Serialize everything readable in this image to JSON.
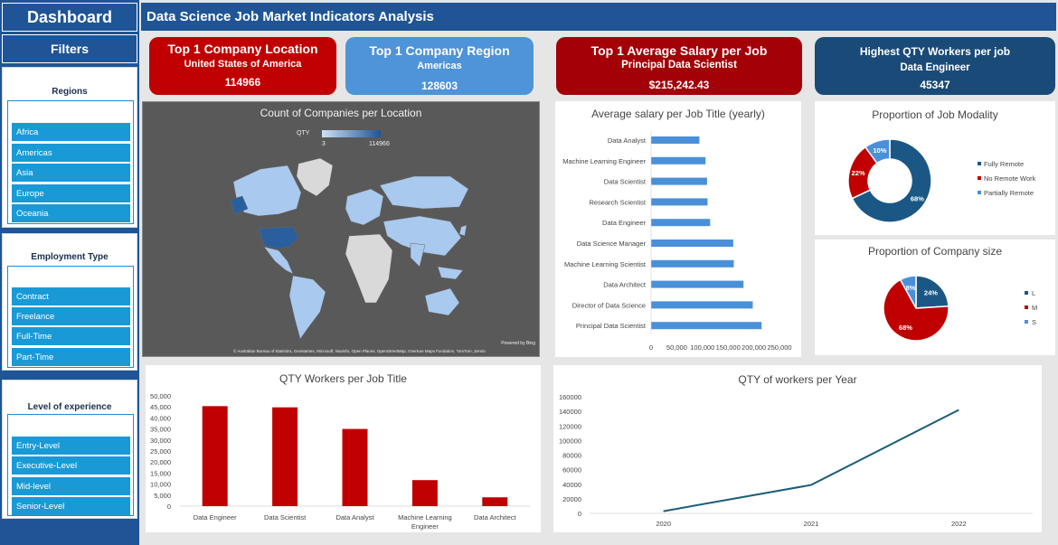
{
  "sidebar": {
    "title": "Dashboard",
    "filters_label": "Filters",
    "regions": {
      "header": "Regions",
      "items": [
        "Africa",
        "Americas",
        "Asia",
        "Europe",
        "Oceania"
      ]
    },
    "employment": {
      "header": "Employment Type",
      "items": [
        "Contract",
        "Freelance",
        "Full-Time",
        "Part-Time"
      ]
    },
    "experience": {
      "header": "Level of experience",
      "items": [
        "Entry-Level",
        "Executive-Level",
        "Mid-level",
        "Senior-Level"
      ]
    }
  },
  "header": {
    "title": "Data Science Job Market Indicators Analysis"
  },
  "kpis": [
    {
      "label": "Top 1 Company Location",
      "value_name": "United States of America",
      "value": "114966",
      "color": "#c00000"
    },
    {
      "label": "Top 1 Company Region",
      "value_name": "Americas",
      "value": "128603",
      "color": "#4f93d8"
    },
    {
      "label": "Top 1 Average Salary per Job",
      "value_name": "Principal Data Scientist",
      "value": "$215,242.43",
      "color": "#a30008"
    },
    {
      "label": "Highest QTY Workers per job",
      "value_name": "Data Engineer",
      "value": "45347",
      "color": "#1a4b78"
    }
  ],
  "map": {
    "title": "Count of Companies per Location",
    "legend_label": "QTY",
    "legend_min": "3",
    "legend_max": "114966",
    "attribution": "© Australian Bureau of Statistics, GeoNames, Microsoft, Navinfo, Open Places, OpenStreetMap, Overture Maps Fundation, TomTom, Zenrin",
    "powered_by": "Powered by Bing"
  },
  "colors": {
    "blue_bar": "#4a90d9",
    "red_bar": "#c00000",
    "navy": "#1a5785",
    "line": "#1a5d7a"
  },
  "charts": {
    "salary": {
      "title": "Average salary per Job Title (yearly)",
      "chart_data": {
        "type": "bar",
        "orientation": "horizontal",
        "categories": [
          "Data Analyst",
          "Machine Learning Engineer",
          "Data Scientist",
          "Research Scientist",
          "Data Engineer",
          "Data Science Manager",
          "Machine Learning Scientist",
          "Data Architect",
          "Director of Data Science",
          "Principal Data Scientist"
        ],
        "values": [
          94000,
          106000,
          109000,
          110000,
          115000,
          160000,
          161000,
          180000,
          198000,
          215242
        ],
        "xlim": [
          0,
          250000
        ],
        "xticks": [
          "0",
          "50,000",
          "100,000",
          "150,000",
          "200,000",
          "250,000"
        ]
      }
    },
    "modality": {
      "title": "Proportion of Job Modality",
      "chart_data": {
        "type": "pie",
        "donut": true,
        "labels": [
          "Fully Remote",
          "No Remote Work",
          "Partially Remote"
        ],
        "values": [
          68,
          22,
          10
        ],
        "data_labels": [
          "68%",
          "22%",
          "10%"
        ],
        "colors": [
          "#1a5785",
          "#c00000",
          "#4a90d9"
        ]
      }
    },
    "company_size": {
      "title": "Proportion of Company size",
      "chart_data": {
        "type": "pie",
        "labels": [
          "L",
          "M",
          "S"
        ],
        "values": [
          24,
          68,
          8
        ],
        "data_labels": [
          "24%",
          "68%",
          "8%"
        ],
        "colors": [
          "#1a5785",
          "#c00000",
          "#4a90d9"
        ]
      }
    },
    "workers_job": {
      "title": "QTY Workers per Job Title",
      "chart_data": {
        "type": "bar",
        "categories": [
          "Data Engineer",
          "Data Scientist",
          "Data Analyst",
          "Machine Learning Engineer",
          "Data Architect"
        ],
        "values": [
          45347,
          44800,
          35000,
          11800,
          4000
        ],
        "ylim": [
          0,
          50000
        ],
        "yticks": [
          "0",
          "5,000",
          "10,000",
          "15,000",
          "20,000",
          "25,000",
          "30,000",
          "35,000",
          "40,000",
          "45,000",
          "50,000"
        ]
      }
    },
    "workers_year": {
      "title": "QTY of workers per Year",
      "chart_data": {
        "type": "line",
        "x": [
          "2020",
          "2021",
          "2022"
        ],
        "values": [
          3000,
          39000,
          142000
        ],
        "ylim": [
          0,
          160000
        ],
        "yticks": [
          "0",
          "20000",
          "40000",
          "60000",
          "80000",
          "100000",
          "120000",
          "140000",
          "160000"
        ]
      }
    }
  }
}
